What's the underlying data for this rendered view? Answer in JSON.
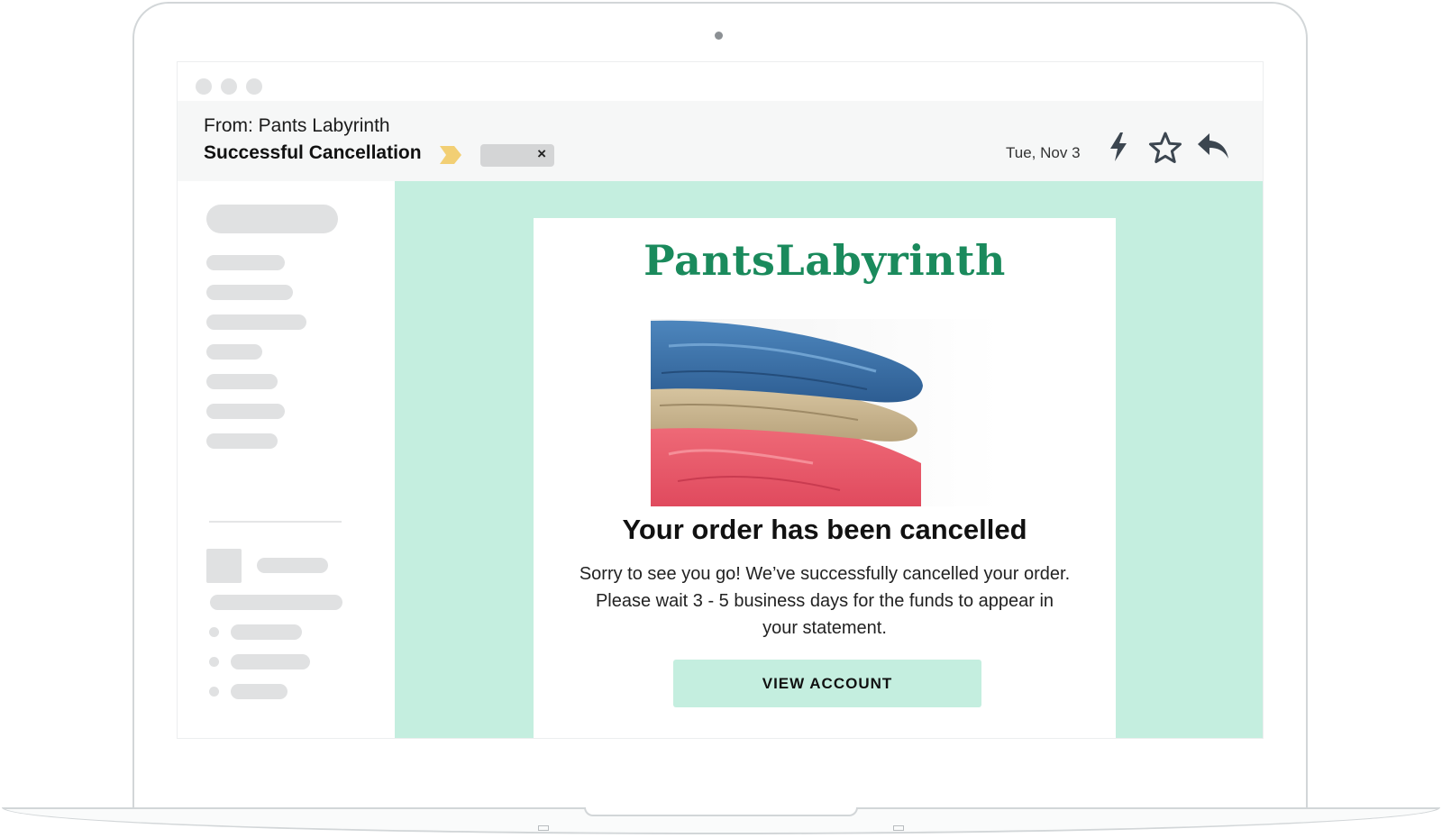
{
  "email": {
    "from": "From: Pants Labyrinth",
    "subject": "Successful Cancellation",
    "tag_close": "×",
    "date": "Tue, Nov 3"
  },
  "icons": {
    "label_arrow": "label-arrow-icon",
    "lightning": "lightning-icon",
    "star": "star-icon",
    "reply": "reply-icon"
  },
  "message": {
    "brand": "PantsLabyrinth",
    "headline": "Your order has been cancelled",
    "body": "Sorry to see you go! We’ve successfully cancelled your order. Please wait 3 - 5 business days for the funds to appear in your statement.",
    "cta_label": "VIEW ACCOUNT"
  },
  "colors": {
    "brand_green": "#1a8a5c",
    "mint_background": "#c4eedf",
    "label_yellow": "#f2cf74"
  }
}
